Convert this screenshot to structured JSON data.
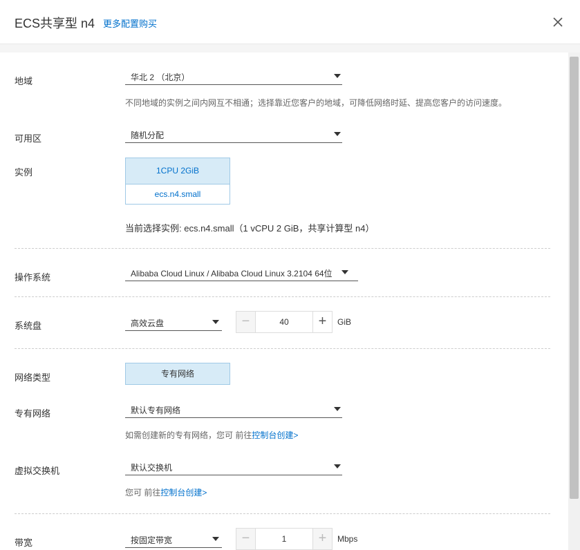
{
  "header": {
    "title": "ECS共享型 n4",
    "more_link": "更多配置购买"
  },
  "region": {
    "label": "地域",
    "value": "华北 2 （北京）",
    "hint": "不同地域的实例之间内网互不相通；选择靠近您客户的地域，可降低网络时延、提高您客户的访问速度。"
  },
  "zone": {
    "label": "可用区",
    "value": "随机分配"
  },
  "instance": {
    "label": "实例",
    "spec": "1CPU 2GiB",
    "type": "ecs.n4.small",
    "current": "当前选择实例: ecs.n4.small（1 vCPU 2 GiB，共享计算型 n4）"
  },
  "os": {
    "label": "操作系统",
    "value": "Alibaba Cloud Linux / Alibaba Cloud Linux 3.2104 64位"
  },
  "system_disk": {
    "label": "系统盘",
    "type": "高效云盘",
    "size": "40",
    "unit": "GiB",
    "minus": "−",
    "plus": "+"
  },
  "network_type": {
    "label": "网络类型",
    "value": "专有网络"
  },
  "vpc": {
    "label": "专有网络",
    "value": "默认专有网络",
    "hint_prefix": "如需创建新的专有网络，您可 前往",
    "hint_link": "控制台创建>"
  },
  "vswitch": {
    "label": "虚拟交换机",
    "value": "默认交换机",
    "hint_prefix": "您可 前往",
    "hint_link": "控制台创建>"
  },
  "bandwidth": {
    "label": "带宽",
    "type": "按固定带宽",
    "value": "1",
    "unit": "Mbps",
    "minus": "−",
    "plus": "+"
  }
}
